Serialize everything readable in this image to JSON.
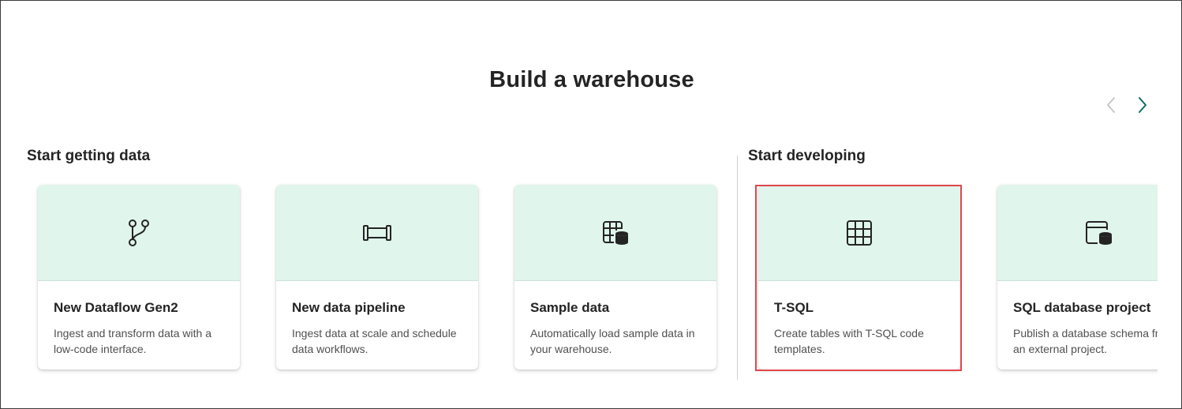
{
  "page": {
    "title": "Build a warehouse"
  },
  "navigation": {
    "prev_icon": "chevron-left-icon",
    "next_icon": "chevron-right-icon"
  },
  "sections": {
    "getting_data": {
      "label": "Start getting data"
    },
    "developing": {
      "label": "Start developing"
    }
  },
  "cards": [
    {
      "icon": "dataflow-branch-icon",
      "title": "New Dataflow Gen2",
      "description": "Ingest and transform data with a low-code interface."
    },
    {
      "icon": "pipeline-icon",
      "title": "New data pipeline",
      "description": "Ingest data at scale and schedule data workflows."
    },
    {
      "icon": "table-database-icon",
      "title": "Sample data",
      "description": "Automatically load sample data in your warehouse."
    },
    {
      "icon": "table-grid-icon",
      "title": "T-SQL",
      "description": "Create tables with T-SQL code templates.",
      "selected": true
    },
    {
      "icon": "database-window-icon",
      "title": "SQL database project",
      "description": "Publish a database schema from an external project."
    }
  ],
  "colors": {
    "card_header_bg": "#e0f5ec",
    "selected_outline": "#e0474c",
    "next_arrow": "#0f6e63",
    "prev_arrow_disabled": "#c4c4c4"
  }
}
